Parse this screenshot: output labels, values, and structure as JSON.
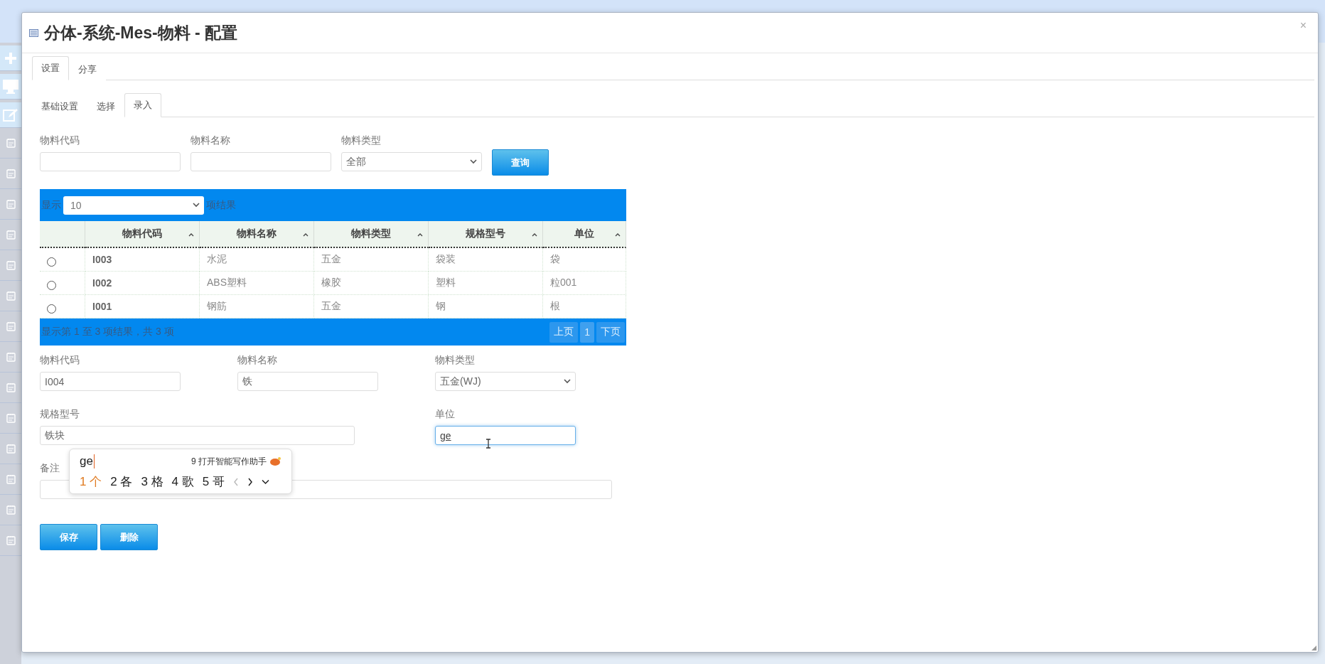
{
  "dialog": {
    "title": "分体-系统-Mes-物料 - 配置",
    "close": "×",
    "tabs": [
      {
        "label": "设置",
        "selected": true
      },
      {
        "label": "分享",
        "selected": false
      }
    ],
    "subtabs": [
      {
        "label": "基础设置",
        "selected": false
      },
      {
        "label": "选择",
        "selected": false
      },
      {
        "label": "录入",
        "selected": true
      }
    ],
    "filter": {
      "fields": [
        {
          "label": "物料代码",
          "kind": "text"
        },
        {
          "label": "物料名称",
          "kind": "text"
        },
        {
          "label": "物料类型",
          "kind": "select",
          "value": "全部"
        }
      ],
      "button": "查询"
    },
    "table": {
      "length_prefix": "显示",
      "length_value": "10",
      "length_suffix": "项结果",
      "columns": [
        "物料代码",
        "物料名称",
        "物料类型",
        "规格型号",
        "单位"
      ],
      "rows": [
        {
          "selected": false,
          "cells": [
            "I003",
            "水泥",
            "五金",
            "袋装",
            "袋"
          ]
        },
        {
          "selected": false,
          "cells": [
            "I002",
            "ABS塑料",
            "橡胶",
            "塑料",
            "粒001"
          ]
        },
        {
          "selected": false,
          "cells": [
            "I001",
            "钢筋",
            "五金",
            "钢",
            "根"
          ]
        }
      ],
      "info": "显示第 1 至 3 项结果，共 3 项",
      "pager": [
        {
          "label": "上页",
          "selected": false
        },
        {
          "label": "1",
          "selected": true
        },
        {
          "label": "下页",
          "selected": false
        }
      ]
    },
    "form": {
      "rows": [
        {
          "fields": [
            {
              "label": "物料代码",
              "kind": "text",
              "value": "I004",
              "focused": false
            },
            {
              "label": "物料名称",
              "kind": "text",
              "value": "铁",
              "focused": false
            },
            {
              "label": "物料类型",
              "kind": "select",
              "value": "五金(WJ)",
              "focused": false
            }
          ]
        },
        {
          "fields": [
            {
              "label": "规格型号",
              "kind": "long",
              "value": "铁块",
              "focused": false
            },
            {
              "label": "单位",
              "kind": "text",
              "value": "ge",
              "focused": true
            }
          ]
        },
        {
          "fields": [
            {
              "label": "备注",
              "kind": "full",
              "focused": false
            }
          ]
        }
      ],
      "buttons": [
        "保存",
        "删除"
      ]
    },
    "ime": {
      "composition": "ge",
      "assistant": "9 打开智能写作助手",
      "candidates": [
        {
          "index": "1",
          "text": "个",
          "selected": true
        },
        {
          "index": "2",
          "text": "各",
          "selected": false
        },
        {
          "index": "3",
          "text": "格",
          "selected": false
        },
        {
          "index": "4",
          "text": "歌",
          "selected": false
        },
        {
          "index": "5",
          "text": "哥",
          "selected": false
        }
      ]
    }
  }
}
